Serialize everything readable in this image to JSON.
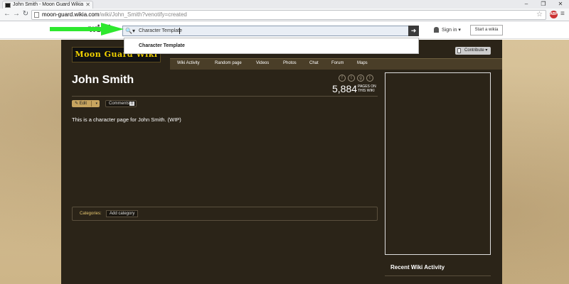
{
  "browser": {
    "tab_title": "John Smith - Moon Guard Wikia",
    "tab_close": "✕",
    "window_buttons": [
      "–",
      "❐",
      "✕"
    ],
    "url_host": "moon-guard.wikia.com",
    "url_path": "/wiki/John_Smith?venotify=created",
    "back": "←",
    "forward": "→",
    "reload": "↻",
    "star": "☆",
    "menu": "≡",
    "adblock_label": "ABP"
  },
  "global_nav": {
    "logo": "wiki",
    "search_scope": "🔍▾",
    "search_value": "Character Template",
    "search_go": "➜",
    "suggestion": "Character Template",
    "sign_in": "Sign in ▾",
    "start_wikia": "Start a wikia"
  },
  "wiki": {
    "wordmark": "Moon Guard Wiki",
    "contribute": "Contribute ▾",
    "nav": [
      "Wiki Activity",
      "Random page",
      "Videos",
      "Photos",
      "Chat",
      "Forum",
      "Maps"
    ]
  },
  "article": {
    "title": "John Smith",
    "social": [
      "f",
      "t",
      "g",
      "t"
    ],
    "page_count": "5,884",
    "pages_label": "PAGES ON THIS WIKI",
    "edit": "✎ Edit",
    "edit_drop": "▾",
    "comments": "Comments",
    "comments_count": "0",
    "body": "This is a character page for John Smith. (WIP)",
    "categories_label": "Categories:",
    "add_category": "Add category"
  },
  "rail": {
    "recent_title": "Recent Wiki Activity"
  }
}
